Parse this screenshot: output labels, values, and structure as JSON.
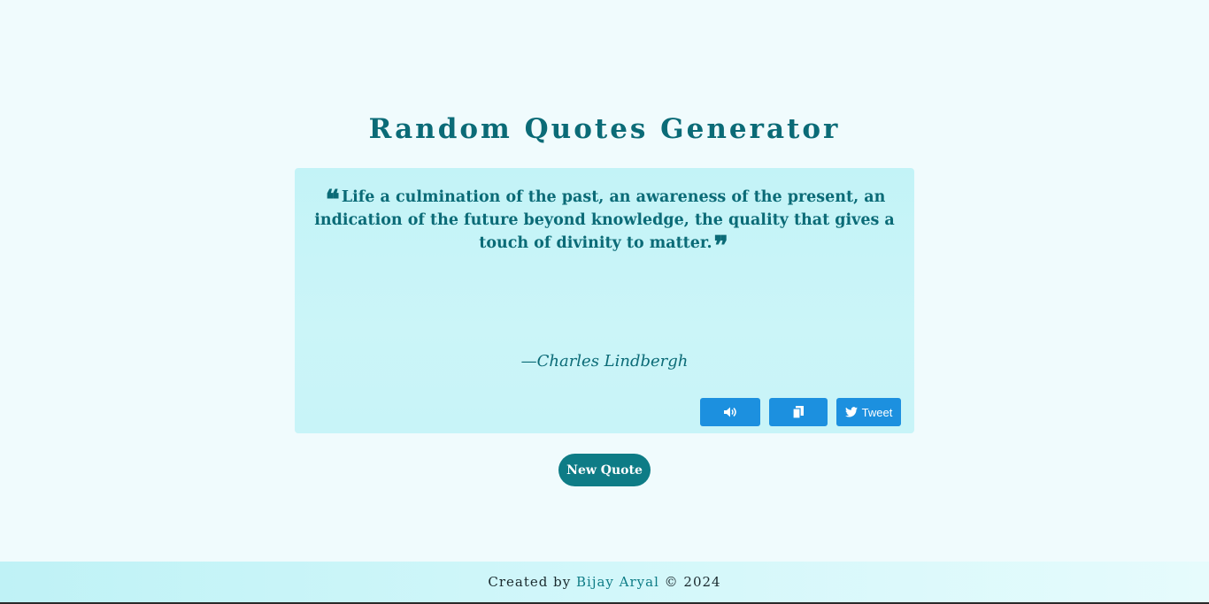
{
  "header": {
    "title": "Random Quotes Generator"
  },
  "quote": {
    "text": "Life a culmination of the past, an awareness of the present, an indication of the future beyond knowledge, the quality that gives a touch of divinity to matter.",
    "author": "—Charles Lindbergh"
  },
  "actions": {
    "speak_icon": "speaker-icon",
    "copy_icon": "copy-icon",
    "tweet_label": "Tweet",
    "tweet_icon": "twitter-icon"
  },
  "new_quote_label": "New Quote",
  "footer": {
    "prefix": "Created by",
    "author_link": "Bijay Aryal",
    "suffix": "© 2024"
  },
  "colors": {
    "accent": "#0b6b77",
    "button_blue": "#1c90df",
    "card_bg": "#c6f4f8",
    "page_bg": "#f0fbfd"
  }
}
